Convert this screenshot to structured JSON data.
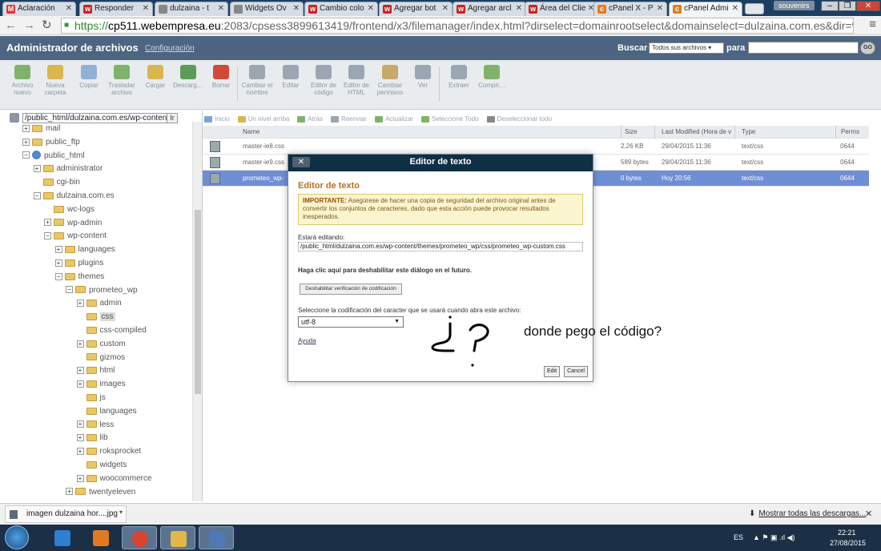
{
  "browser": {
    "tabs": [
      {
        "title": "Aclaración",
        "favicon": "gmail-icon",
        "fav_color": "#d33"
      },
      {
        "title": "Responder",
        "favicon": "w-icon",
        "fav_color": "#c22"
      },
      {
        "title": "dulzaina - t",
        "favicon": "page-icon",
        "fav_color": "#888"
      },
      {
        "title": "Widgets Ov",
        "favicon": "page-icon",
        "fav_color": "#888"
      },
      {
        "title": "Cambio colo",
        "favicon": "w-icon",
        "fav_color": "#c22"
      },
      {
        "title": "Agregar bot",
        "favicon": "w-icon",
        "fav_color": "#c22"
      },
      {
        "title": "Agregar arcl",
        "favicon": "w-icon",
        "fav_color": "#c22"
      },
      {
        "title": "Área del Clie",
        "favicon": "w-icon",
        "fav_color": "#c22"
      },
      {
        "title": "cPanel X - P",
        "favicon": "cpanel-icon",
        "fav_color": "#e87c1e"
      },
      {
        "title": "cPanel Admi",
        "favicon": "cpanel-icon",
        "fav_color": "#e87c1e"
      }
    ],
    "user_badge": "souvenirs",
    "url_scheme": "https://",
    "url_host": "cp511.webempresa.eu",
    "url_path": ":2083/cpsess3899613419/frontend/x3/filemanager/index.html?dirselect=domainrootselect&domainselect=dulzaina.com.es&dir=%2Fhome2%2Fso"
  },
  "header": {
    "title": "Administrador de archivos",
    "config_link": "Configuración",
    "search_label": "Buscar",
    "search_scope": "Todos sus archivos",
    "search_para": "para",
    "go_label": "GO"
  },
  "toolbar": [
    {
      "label": "Archivo nuevo",
      "icon": "new-file-icon",
      "color": "#7fb36a"
    },
    {
      "label": "Nueva carpeta",
      "icon": "new-folder-icon",
      "color": "#d9b64f"
    },
    {
      "label": "Copiar",
      "icon": "copy-icon",
      "color": "#8eb2d8"
    },
    {
      "label": "Trasladar archivo",
      "icon": "move-icon",
      "color": "#7fb36a"
    },
    {
      "label": "Cargar",
      "icon": "upload-icon",
      "color": "#d9b64f"
    },
    {
      "label": "Descarg…",
      "icon": "download-icon",
      "color": "#5a9e55"
    },
    {
      "label": "Borrar",
      "icon": "delete-icon",
      "color": "#d04a3a"
    },
    {
      "label": "Cambiar el nombre",
      "icon": "rename-icon",
      "color": "#9aa6b2"
    },
    {
      "label": "Editar",
      "icon": "edit-icon",
      "color": "#9aa6b2"
    },
    {
      "label": "Editor de código",
      "icon": "code-editor-icon",
      "color": "#9aa6b2"
    },
    {
      "label": "Editor de HTML",
      "icon": "html-editor-icon",
      "color": "#9aa6b2"
    },
    {
      "label": "Cambiar permisos",
      "icon": "permissions-icon",
      "color": "#c9a86a"
    },
    {
      "label": "Ver",
      "icon": "view-icon",
      "color": "#9aa6b2"
    },
    {
      "label": "Extraer",
      "icon": "extract-icon",
      "color": "#9aa6b2"
    },
    {
      "label": "Compri…",
      "icon": "compress-icon",
      "color": "#7fb36a"
    }
  ],
  "tree": {
    "path_value": "/public_html/dulzaina.com.es/wp-content",
    "path_go": "Ir",
    "nodes": [
      {
        "label": "mail",
        "indent": 1,
        "exp": "+",
        "icon": "folder-icon"
      },
      {
        "label": "public_ftp",
        "indent": 1,
        "exp": "+",
        "icon": "folder-icon"
      },
      {
        "label": "public_html",
        "indent": 1,
        "exp": "−",
        "icon": "globe-icon"
      },
      {
        "label": "administrator",
        "indent": 2,
        "exp": "+",
        "icon": "folder-icon"
      },
      {
        "label": "cgi-bin",
        "indent": 2,
        "exp": "",
        "icon": "folder-icon"
      },
      {
        "label": "dulzaina.com.es",
        "indent": 2,
        "exp": "−",
        "icon": "folder-icon"
      },
      {
        "label": "wc-logs",
        "indent": 3,
        "exp": "",
        "icon": "folder-icon"
      },
      {
        "label": "wp-admin",
        "indent": 3,
        "exp": "+",
        "icon": "folder-icon"
      },
      {
        "label": "wp-content",
        "indent": 3,
        "exp": "−",
        "icon": "folder-icon"
      },
      {
        "label": "languages",
        "indent": 4,
        "exp": "+",
        "icon": "folder-icon"
      },
      {
        "label": "plugins",
        "indent": 4,
        "exp": "+",
        "icon": "folder-icon"
      },
      {
        "label": "themes",
        "indent": 4,
        "exp": "−",
        "icon": "folder-icon"
      },
      {
        "label": "prometeo_wp",
        "indent": 5,
        "exp": "−",
        "icon": "folder-icon"
      },
      {
        "label": "admin",
        "indent": 6,
        "exp": "+",
        "icon": "folder-icon"
      },
      {
        "label": "css",
        "indent": 6,
        "exp": "",
        "icon": "folder-icon",
        "selected": true
      },
      {
        "label": "css-compiled",
        "indent": 6,
        "exp": "",
        "icon": "folder-icon"
      },
      {
        "label": "custom",
        "indent": 6,
        "exp": "+",
        "icon": "folder-icon"
      },
      {
        "label": "gizmos",
        "indent": 6,
        "exp": "",
        "icon": "folder-icon"
      },
      {
        "label": "html",
        "indent": 6,
        "exp": "+",
        "icon": "folder-icon"
      },
      {
        "label": "images",
        "indent": 6,
        "exp": "+",
        "icon": "folder-icon"
      },
      {
        "label": "js",
        "indent": 6,
        "exp": "",
        "icon": "folder-icon"
      },
      {
        "label": "languages",
        "indent": 6,
        "exp": "",
        "icon": "folder-icon"
      },
      {
        "label": "less",
        "indent": 6,
        "exp": "+",
        "icon": "folder-icon"
      },
      {
        "label": "lib",
        "indent": 6,
        "exp": "+",
        "icon": "folder-icon"
      },
      {
        "label": "roksprocket",
        "indent": 6,
        "exp": "+",
        "icon": "folder-icon"
      },
      {
        "label": "widgets",
        "indent": 6,
        "exp": "",
        "icon": "folder-icon"
      },
      {
        "label": "woocommerce",
        "indent": 6,
        "exp": "+",
        "icon": "folder-icon"
      },
      {
        "label": "twentyeleven",
        "indent": 5,
        "exp": "+",
        "icon": "folder-icon"
      }
    ]
  },
  "actions": [
    {
      "label": "Inicio",
      "icon": "home-icon",
      "color": "#7aa7d0"
    },
    {
      "label": "Un nivel arriba",
      "icon": "up-level-icon",
      "color": "#d9b64f"
    },
    {
      "label": "Atrás",
      "icon": "back-icon",
      "color": "#7fb36a"
    },
    {
      "label": "Reenviar",
      "icon": "forward-icon",
      "color": "#9aa6b2"
    },
    {
      "label": "Actualizar",
      "icon": "refresh-icon",
      "color": "#7fb36a"
    },
    {
      "label": "Seleccione Todo",
      "icon": "select-all-icon",
      "color": "#7fb36a"
    },
    {
      "label": "Deseleccionar todo",
      "icon": "deselect-all-icon",
      "color": "#888"
    }
  ],
  "files": {
    "columns": [
      "Name",
      "Size",
      "Last Modified (Hora de v",
      "Type",
      "Perms"
    ],
    "rows": [
      {
        "name": "master-ie8.css",
        "size": "2,26 KB",
        "modified": "29/04/2015 11:36",
        "type": "text/css",
        "perms": "0644"
      },
      {
        "name": "master-ie9.css",
        "size": "589 bytes",
        "modified": "29/04/2015 11:36",
        "type": "text/css",
        "perms": "0644"
      },
      {
        "name": "prometeo_wp-",
        "size": "0 bytes",
        "modified": "Hoy 20:56",
        "type": "text/css",
        "perms": "0644",
        "selected": true
      }
    ]
  },
  "dialog": {
    "title": "Editor de texto",
    "heading": "Editor de texto",
    "warning_bold": "IMPORTANTE:",
    "warning_text": "Asegúrese de hacer una copia de seguridad del archivo original antes de convertir los conjuntos de caracteres, dado que esta acción puede provocar resultados inesperados.",
    "editing_label": "Estará editando:",
    "editing_path": "/public_html/dulzaina.com.es/wp-content/themes/prometeo_wp/css/prometeo_wp-custom.css",
    "hint": "Haga clic aquí para deshabilitar este diálogo en el futuro.",
    "disable_button": "Deshabilitar verificación de codificación",
    "encoding_label": "Seleccione la codificación del caracter que se usará cuando abra este archivo:",
    "encoding_value": "utf-8",
    "help_link": "Ayuda",
    "edit_button": "Edit",
    "cancel_button": "Cancel"
  },
  "annotation": {
    "note": "donde pego el código?"
  },
  "downloads": {
    "file_name": "imagen dulzaina hor....jpg",
    "show_all": "Mostrar todas las descargas..."
  },
  "taskbar": {
    "apps": [
      {
        "name": "internet-explorer-icon",
        "color": "#2d7fd2"
      },
      {
        "name": "media-player-icon",
        "color": "#e07a20"
      },
      {
        "name": "chrome-icon",
        "color": "#d9442e"
      },
      {
        "name": "file-explorer-icon",
        "color": "#e2b74a"
      },
      {
        "name": "paint-icon",
        "color": "#4e79b5"
      }
    ],
    "lang": "ES",
    "time": "22:21",
    "date": "27/08/2015"
  }
}
